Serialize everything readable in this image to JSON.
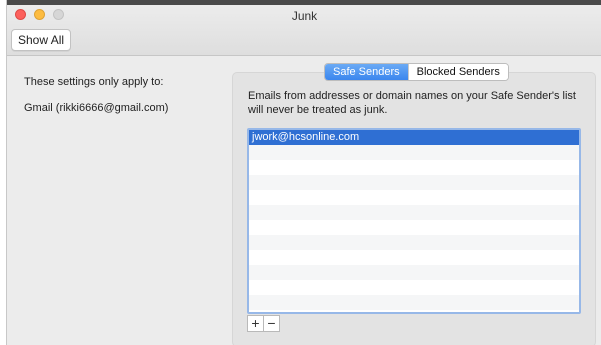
{
  "window": {
    "title": "Junk",
    "show_all_label": "Show All"
  },
  "left": {
    "settings_label": "These settings only apply to:",
    "account": "Gmail (rikki6666@gmail.com)"
  },
  "tabs": [
    {
      "label": "Safe Senders",
      "selected": true
    },
    {
      "label": "Blocked Senders",
      "selected": false
    }
  ],
  "description": "Emails from addresses or domain names on your Safe Sender's list will never be treated as junk.",
  "list": {
    "items": [
      "jwork@hcsonline.com",
      "",
      "",
      "",
      "",
      "",
      "",
      "",
      "",
      "",
      "",
      ""
    ],
    "selected_index": 0
  },
  "buttons": {
    "add_label": "+",
    "remove_label": "−"
  },
  "colors": {
    "accent": "#3b86ee",
    "selection": "#2f6fd3"
  }
}
